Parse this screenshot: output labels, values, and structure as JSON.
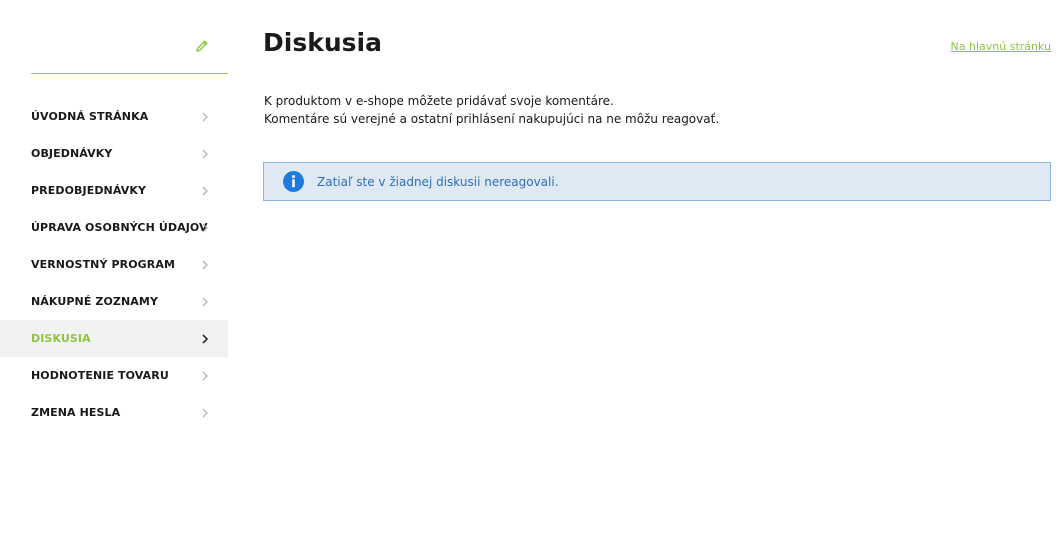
{
  "sidebar": {
    "items": [
      {
        "label": "ÚVODNÁ STRÁNKA"
      },
      {
        "label": "OBJEDNÁVKY"
      },
      {
        "label": "PREDOBJEDNÁVKY"
      },
      {
        "label": "ÚPRAVA OSOBNÝCH ÚDAJOV"
      },
      {
        "label": "VERNOSTNÝ PROGRAM"
      },
      {
        "label": "NÁKUPNÉ ZOZNAMY"
      },
      {
        "label": "DISKUSIA"
      },
      {
        "label": "HODNOTENIE TOVARU"
      },
      {
        "label": "ZMENA HESLA"
      }
    ],
    "active_index": 6,
    "edit_icon": "pencil-icon"
  },
  "main": {
    "title": "Diskusia",
    "home_link": "Na hlavnú stránku",
    "intro_lines": [
      "K produktom v e-shope môžete pridávať svoje komentáre.",
      "Komentáre sú verejné a ostatní prihlásení nakupujúci na ne môžu reagovať."
    ],
    "info_message": "Zatiaľ ste v žiadnej diskusii nereagovali."
  },
  "colors": {
    "accent": "#8dc63f",
    "info_bg": "#dfe9f4",
    "info_border": "#8fb4db",
    "info_text": "#2f6fb5",
    "info_icon": "#1f7ae0",
    "active_bg": "#f2f2f2"
  }
}
